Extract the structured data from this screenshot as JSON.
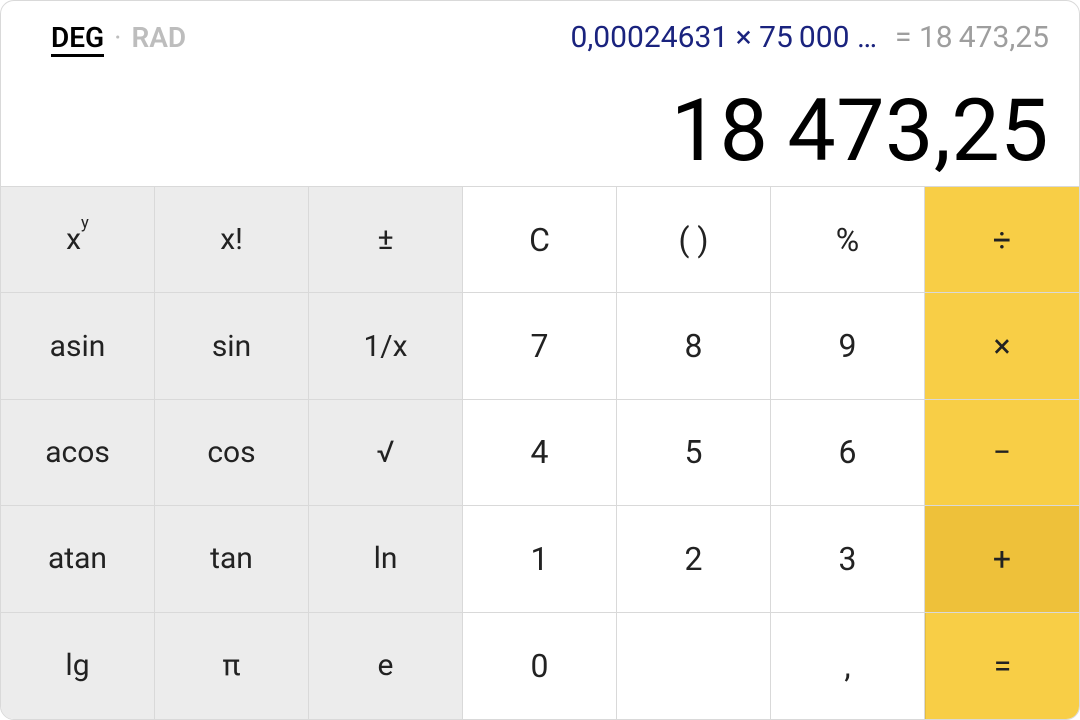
{
  "mode": {
    "deg": "DEG",
    "sep": "·",
    "rad": "RAD"
  },
  "expression": "0,00024631 × 75 000 …",
  "prev_result_prefix": "= ",
  "prev_result": "18 473,25",
  "result_a": "18",
  "result_b": "473,25",
  "keys": {
    "r0": {
      "sci0": {
        "base": "x",
        "sup": "y"
      },
      "sci1": "x!",
      "sci2": "±",
      "n0": "C",
      "n1": "( )",
      "n2": "%",
      "op": "÷"
    },
    "r1": {
      "sci0": "asin",
      "sci1": "sin",
      "sci2": "1/x",
      "n0": "7",
      "n1": "8",
      "n2": "9",
      "op": "×"
    },
    "r2": {
      "sci0": "acos",
      "sci1": "cos",
      "sci2": "√",
      "n0": "4",
      "n1": "5",
      "n2": "6",
      "op": "−"
    },
    "r3": {
      "sci0": "atan",
      "sci1": "tan",
      "sci2": "ln",
      "n0": "1",
      "n1": "2",
      "n2": "3",
      "op": "+"
    },
    "r4": {
      "sci0": "lg",
      "sci1": "π",
      "sci2": "e",
      "n0": "0",
      "n1": "",
      "n2": ",",
      "op": "="
    }
  }
}
